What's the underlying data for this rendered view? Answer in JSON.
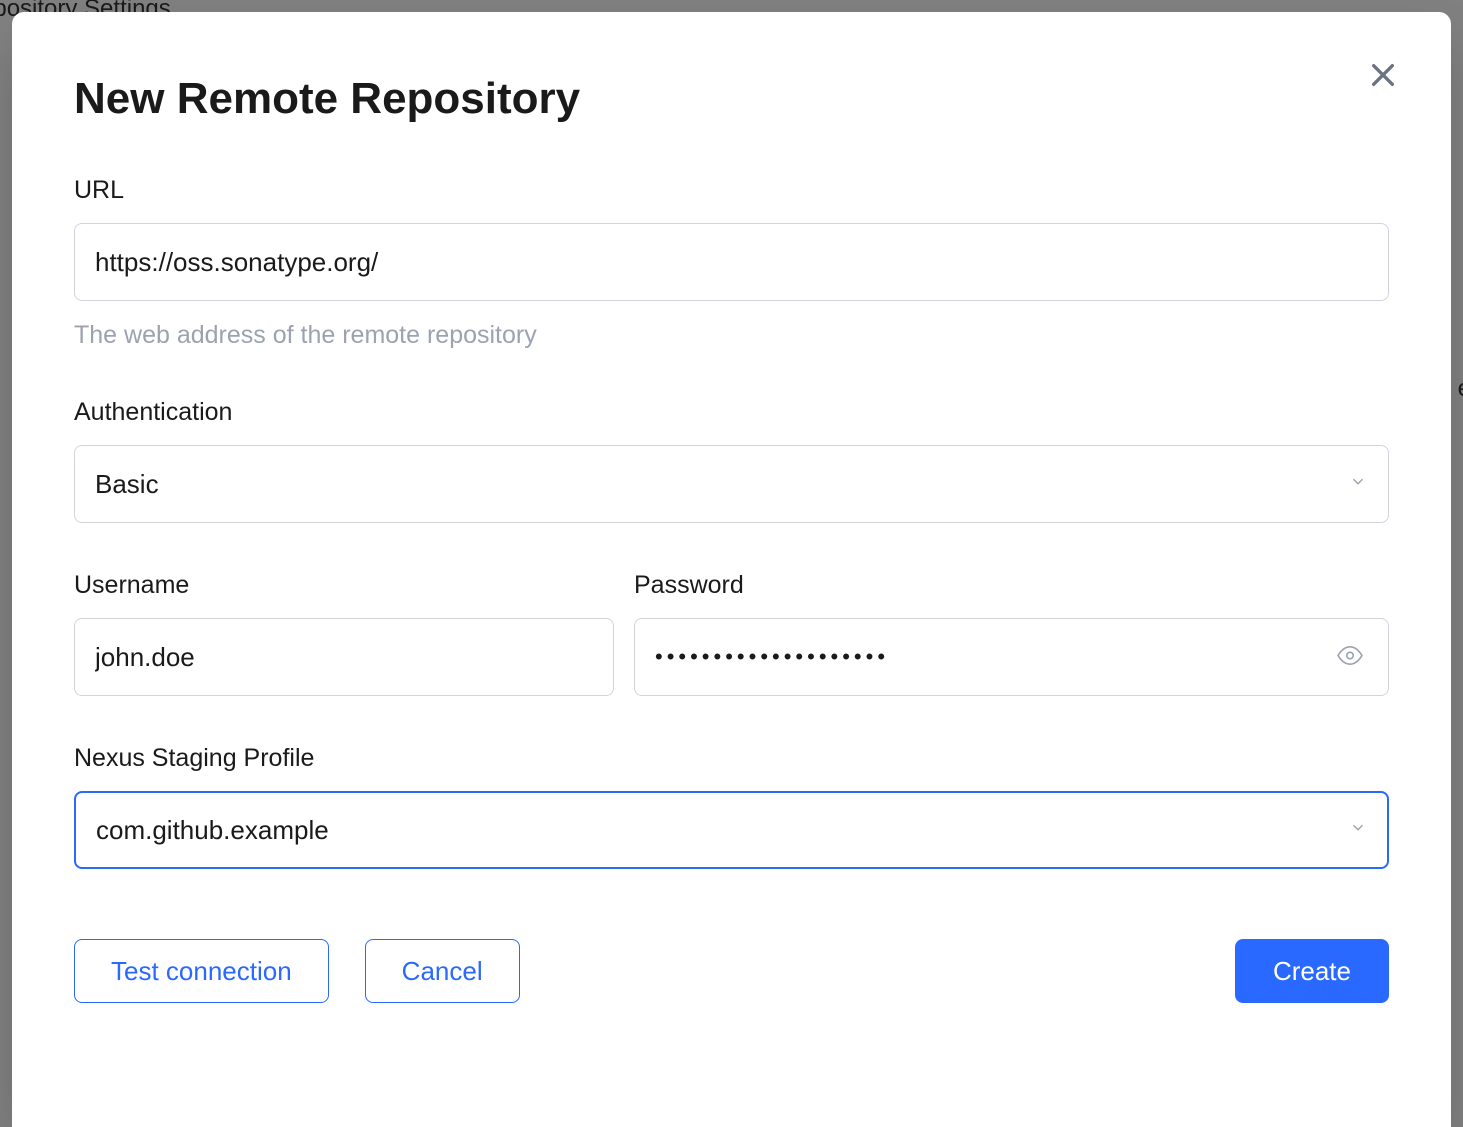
{
  "backdrop": {
    "top_text": "epository Settings",
    "right_text": "e"
  },
  "modal": {
    "title": "New Remote Repository",
    "url": {
      "label": "URL",
      "value": "https://oss.sonatype.org/",
      "help": "The web address of the remote repository"
    },
    "authentication": {
      "label": "Authentication",
      "value": "Basic"
    },
    "username": {
      "label": "Username",
      "value": "john.doe"
    },
    "password": {
      "label": "Password",
      "value": "••••••••••••••••••••"
    },
    "staging": {
      "label": "Nexus Staging Profile",
      "value": "com.github.example"
    },
    "buttons": {
      "test": "Test connection",
      "cancel": "Cancel",
      "create": "Create"
    }
  }
}
